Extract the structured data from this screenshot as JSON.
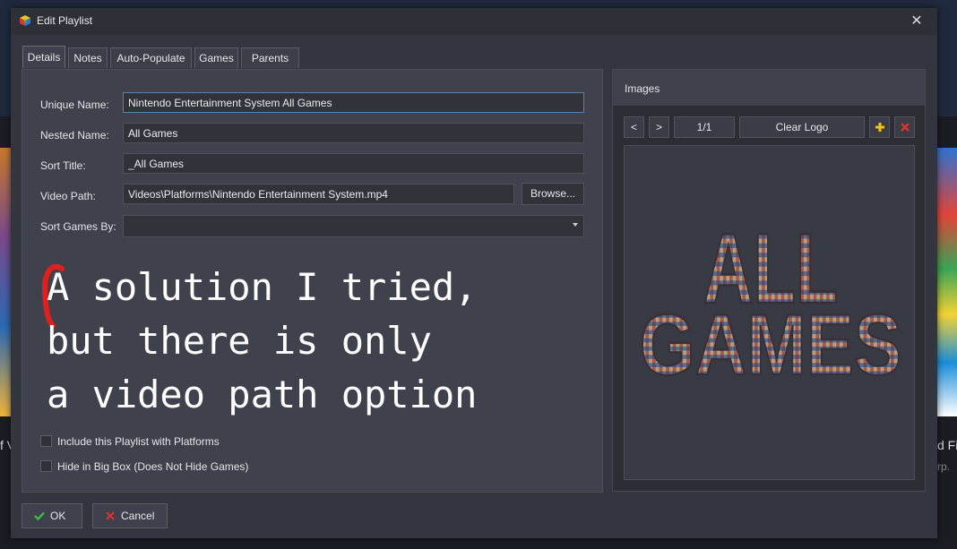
{
  "dialog": {
    "title": "Edit Playlist",
    "close_glyph": "✕"
  },
  "tabs": [
    {
      "label": "Details",
      "active": true
    },
    {
      "label": "Notes"
    },
    {
      "label": "Auto-Populate"
    },
    {
      "label": "Games"
    },
    {
      "label": "Parents"
    }
  ],
  "fields": {
    "unique_name": {
      "label": "Unique Name:",
      "value": "Nintendo Entertainment System All Games"
    },
    "nested_name": {
      "label": "Nested Name:",
      "value": "All Games"
    },
    "sort_title": {
      "label": "Sort Title:",
      "value": "_All Games"
    },
    "video_path": {
      "label": "Video Path:",
      "value": "Videos\\Platforms\\Nintendo Entertainment System.mp4"
    },
    "browse_label": "Browse...",
    "sort_games_by": {
      "label": "Sort Games By:",
      "value": ""
    }
  },
  "annotation": {
    "text": "A solution I tried,\nbut there is only\na video path option",
    "color": "#ffffff",
    "mark_color": "#e0201c"
  },
  "checkboxes": [
    {
      "label": "Include this Playlist with Platforms",
      "checked": false
    },
    {
      "label": "Hide in Big Box (Does Not Hide Games)",
      "checked": false
    }
  ],
  "images": {
    "title": "Images",
    "prev": "<",
    "next": ">",
    "page": "1/1",
    "type_label": "Clear Logo",
    "logo_text_line1": "ALL",
    "logo_text_line2": "GAMES"
  },
  "footer": {
    "ok_label": "OK",
    "cancel_label": "Cancel"
  },
  "background": {
    "left_text": "f V",
    "right_text": "d Fig",
    "right_sub": "rp."
  },
  "colors": {
    "dialog_bg": "#34363f",
    "panel_bg": "#3f414c",
    "accent_green": "#3cc34a",
    "accent_red": "#d9352c",
    "accent_yellow": "#f2c21b"
  }
}
